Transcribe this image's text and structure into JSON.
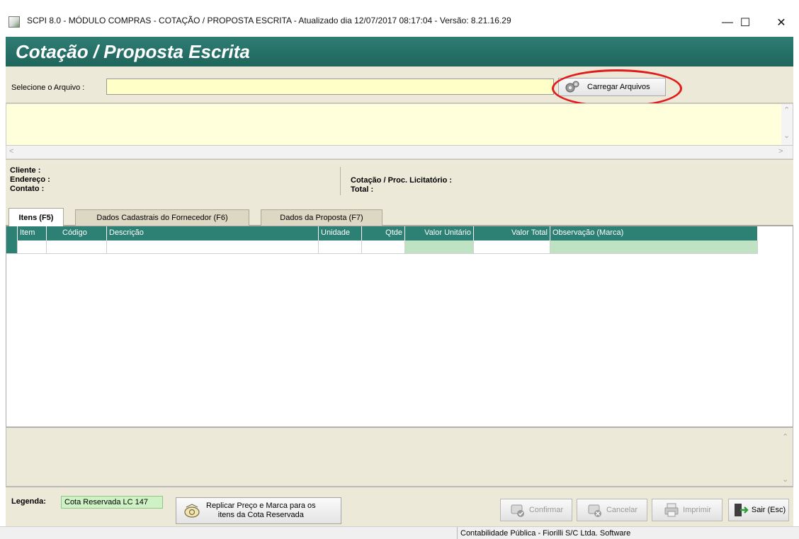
{
  "window": {
    "title": "SCPI 8.0 - MÓDULO COMPRAS - COTAÇÃO / PROPOSTA ESCRITA - Atualizado dia 12/07/2017 08:17:04 - Versão: 8.21.16.29",
    "controls": [
      "minimize-icon",
      "maximize-icon",
      "close-icon"
    ]
  },
  "header": {
    "title": "Cotação / Proposta Escrita"
  },
  "file_select": {
    "label": "Selecione o Arquivo :",
    "value": "",
    "load_button": "Carregar Arquivos"
  },
  "info": {
    "cliente": "Cliente :",
    "endereco": "Endereço :",
    "contato": "Contato :",
    "cotacao": "Cotação / Proc. Licitatório :",
    "total": "Total :"
  },
  "tabs": [
    {
      "label": "Itens (F5)",
      "active": true
    },
    {
      "label": "Dados Cadastrais do Fornecedor (F6)",
      "active": false
    },
    {
      "label": "Dados da Proposta (F7)",
      "active": false
    }
  ],
  "grid": {
    "columns": [
      "Item",
      "Código",
      "Descrição",
      "Unidade",
      "Qtde",
      "Valor Unitário",
      "Valor Total",
      "Observação (Marca)"
    ],
    "rows": [
      [
        "",
        "",
        "",
        "",
        "",
        "",
        "",
        ""
      ]
    ]
  },
  "legend": {
    "label": "Legenda:",
    "badge": "Cota Reservada LC 147",
    "badge_color": "#cff1c6"
  },
  "replicate_button": {
    "line1": "Replicar Preço e Marca para os",
    "line2": "itens da Cota Reservada"
  },
  "actions": {
    "confirmar": "Confirmar",
    "cancelar": "Cancelar",
    "imprimir": "Imprimir",
    "sair": "Sair (Esc)"
  },
  "status": {
    "text": "Contabilidade Pública - Fiorilli S/C Ltda. Software"
  },
  "colors": {
    "header": "#2f7d73",
    "grid_header": "#2c8074",
    "panel": "#ece9d8",
    "memo": "#ffffdc",
    "highlight_circle": "#e21b1b"
  }
}
